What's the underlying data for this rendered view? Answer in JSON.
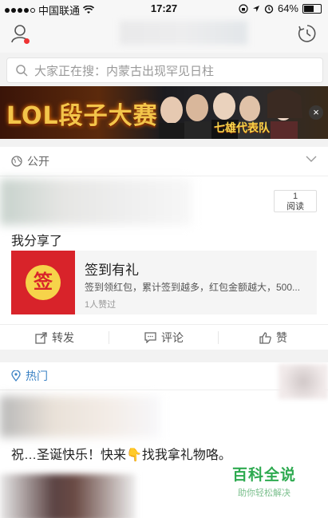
{
  "status_bar": {
    "carrier": "中国联通",
    "time": "17:27",
    "battery": "64%",
    "battery_level": 0.64
  },
  "search": {
    "placeholder": "大家正在搜：内蒙古出现罕见日柱"
  },
  "banner": {
    "title": "LOL段子大赛",
    "subtitle": "七雄代表队",
    "close": "×"
  },
  "post": {
    "visibility": "公开",
    "read_count": "1",
    "read_label": "阅读",
    "text": "我分享了",
    "share": {
      "icon_char": "签",
      "title": "签到有礼",
      "desc": "签到领红包，累计签到越多，红包金额越大，500...",
      "likes": "1人赞过"
    },
    "actions": {
      "forward": "转发",
      "comment": "评论",
      "like": "赞"
    }
  },
  "hot": {
    "label": "热门",
    "text": "祝…圣诞快乐！快来👇找我拿礼物咯。"
  },
  "watermark": {
    "name": "百科全说",
    "slogan": "助你轻松解决"
  }
}
